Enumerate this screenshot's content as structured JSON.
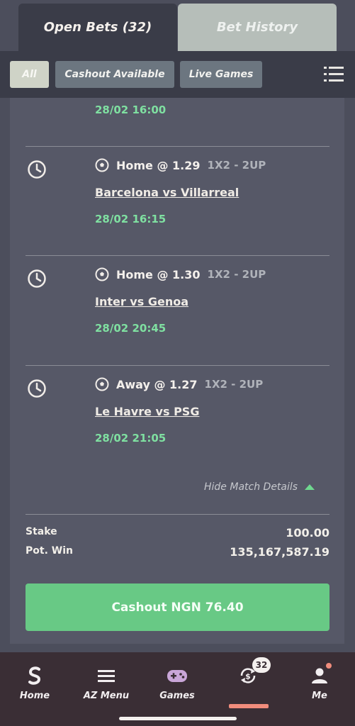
{
  "tabs": {
    "open_bets": "Open Bets (32)",
    "bet_history": "Bet History"
  },
  "filters": {
    "all": "All",
    "cashout_available": "Cashout Available",
    "live_games": "Live Games"
  },
  "first_bet_time": "28/02 16:00",
  "bets": [
    {
      "selection": "Home @ 1.29",
      "market": "1X2 - 2UP",
      "match": "Barcelona vs Villarreal",
      "kickoff": "28/02 16:15"
    },
    {
      "selection": "Home @ 1.30",
      "market": "1X2 - 2UP",
      "match": "Inter vs Genoa",
      "kickoff": "28/02 20:45"
    },
    {
      "selection": "Away @ 1.27",
      "market": "1X2 - 2UP",
      "match": "Le Havre vs PSG",
      "kickoff": "28/02 21:05"
    }
  ],
  "hide_details": "Hide Match Details",
  "summary": {
    "stake_label": "Stake",
    "stake_value": "100.00",
    "potwin_label": "Pot. Win",
    "potwin_value": "135,167,587.19"
  },
  "cashout_button": "Cashout NGN 76.40",
  "nav": {
    "home": "Home",
    "az_menu": "AZ Menu",
    "games": "Games",
    "me": "Me",
    "badge": "32"
  },
  "colors": {
    "accent_green": "#68c985",
    "time_green": "#7fe0a1",
    "nav_bg": "#3a2e35",
    "active_indicator": "#f08c7c"
  }
}
